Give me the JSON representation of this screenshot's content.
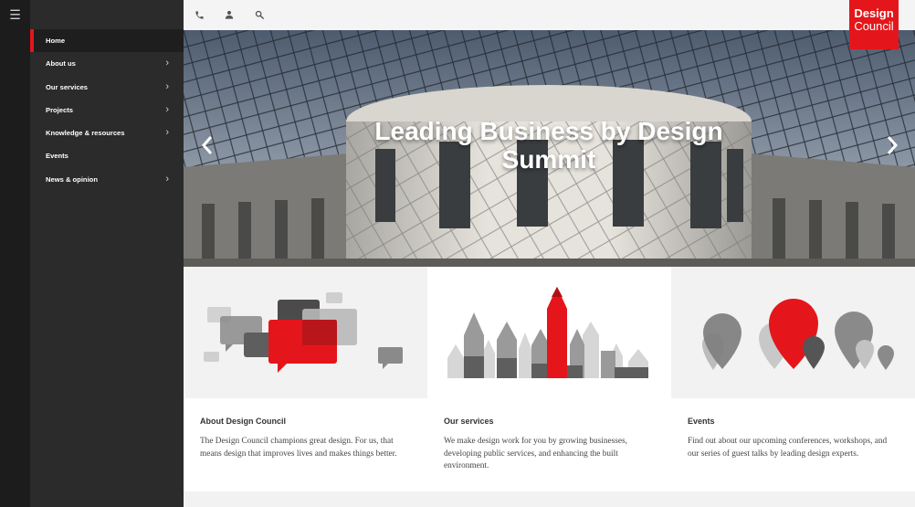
{
  "colors": {
    "accent": "#e4161b",
    "sidebar_bg": "#2b2b2b",
    "rail_bg": "#1c1c1c"
  },
  "rail": {
    "menu_icon": "hamburger-icon"
  },
  "topbar": {
    "icons": [
      "phone-icon",
      "user-icon",
      "search-icon"
    ]
  },
  "logo": {
    "line1": "Design",
    "line2": "Council"
  },
  "sidebar": {
    "items": [
      {
        "label": "Home",
        "active": true,
        "has_children": false
      },
      {
        "label": "About us",
        "active": false,
        "has_children": true
      },
      {
        "label": "Our services",
        "active": false,
        "has_children": true
      },
      {
        "label": "Projects",
        "active": false,
        "has_children": true
      },
      {
        "label": "Knowledge & resources",
        "active": false,
        "has_children": true
      },
      {
        "label": "Events",
        "active": false,
        "has_children": false
      },
      {
        "label": "News & opinion",
        "active": false,
        "has_children": true
      }
    ]
  },
  "hero": {
    "title": "Leading Business by Design Summit",
    "prev_icon": "chevron-left-icon",
    "next_icon": "chevron-right-icon"
  },
  "cards": [
    {
      "title": "About Design Council",
      "text": "The Design Council champions great design. For us, that means design that improves lives and makes things better.",
      "illustration": "speech-bubbles"
    },
    {
      "title": "Our services",
      "text": "We make design work for you by growing businesses, developing public services, and enhancing the built environment.",
      "illustration": "pencil-skyline"
    },
    {
      "title": "Events",
      "text": "Find out about our upcoming conferences, workshops, and our series of guest talks by leading design experts.",
      "illustration": "map-pins"
    }
  ]
}
